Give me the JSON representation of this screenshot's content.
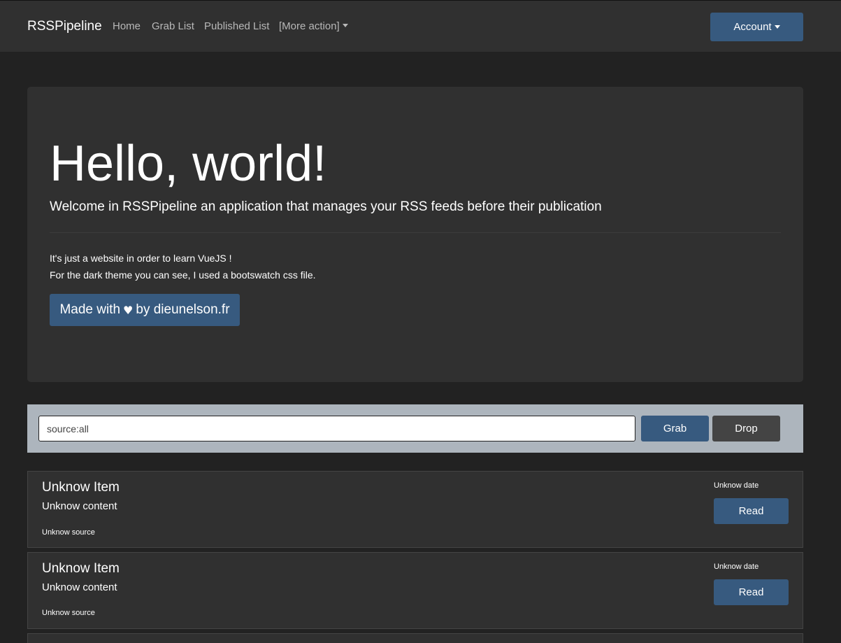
{
  "navbar": {
    "brand": "RSSPipeline",
    "links": [
      "Home",
      "Grab List",
      "Published List"
    ],
    "more_action": "[More action]",
    "account": "Account"
  },
  "hero": {
    "title": "Hello, world!",
    "lead": "Welcome in RSSPipeline an application that manages your RSS feeds before their publication",
    "line1": "It's just a website in order to learn VueJS !",
    "line2": "For the dark theme you can see, I used a bootswatch css file.",
    "made_prefix": "Made with",
    "heart": "♥",
    "made_suffix": "by dieunelson.fr"
  },
  "search": {
    "value": "source:all",
    "grab_label": "Grab",
    "drop_label": "Drop"
  },
  "items": [
    {
      "title": "Unknow Item",
      "content": "Unknow content",
      "source": "Unknow source",
      "date": "Unknow date",
      "read_label": "Read"
    },
    {
      "title": "Unknow Item",
      "content": "Unknow content",
      "source": "Unknow source",
      "date": "Unknow date",
      "read_label": "Read"
    }
  ],
  "colors": {
    "page_bg": "#222222",
    "navbar_bg": "#303030",
    "primary": "#375a7f",
    "secondary": "#444444",
    "search_bar_bg": "#adb5bd"
  }
}
